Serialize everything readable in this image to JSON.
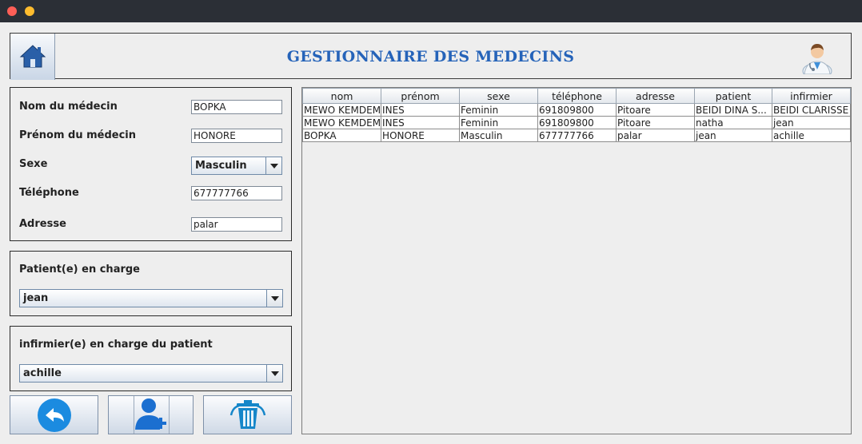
{
  "header": {
    "title": "GESTIONNAIRE DES MEDECINS"
  },
  "form": {
    "nom_label": "Nom du médecin",
    "nom_value": "BOPKA",
    "prenom_label": "Prénom du médecin",
    "prenom_value": "HONORE",
    "sexe_label": "Sexe",
    "sexe_value": "Masculin",
    "telephone_label": "Téléphone",
    "telephone_value": "677777766",
    "adresse_label": "Adresse",
    "adresse_value": "palar"
  },
  "patient_panel": {
    "label": "Patient(e) en charge",
    "selected": "jean"
  },
  "infirmier_panel": {
    "label": "infirmier(e) en charge du patient",
    "selected": "achille"
  },
  "table": {
    "columns": [
      "nom",
      "prénom",
      "sexe",
      "téléphone",
      "adresse",
      "patient",
      "infirmier"
    ],
    "rows": [
      [
        "MEWO KEMDEM",
        "INES",
        "Feminin",
        "691809800",
        "Pitoare",
        "BEIDI DINA S...",
        "BEIDI CLARISSE"
      ],
      [
        "MEWO KEMDEM",
        "INES",
        "Feminin",
        "691809800",
        "Pitoare",
        "natha",
        "jean"
      ],
      [
        "BOPKA",
        "HONORE",
        "Masculin",
        "677777766",
        "palar",
        "jean",
        "achille"
      ]
    ]
  },
  "colors": {
    "title": "#2563b9",
    "icon_blue": "#1b8be0",
    "home_blue": "#2a5fa8"
  },
  "icons": [
    "home-icon",
    "doctor-icon",
    "back-arrow-icon",
    "add-user-icon",
    "trash-icon"
  ]
}
